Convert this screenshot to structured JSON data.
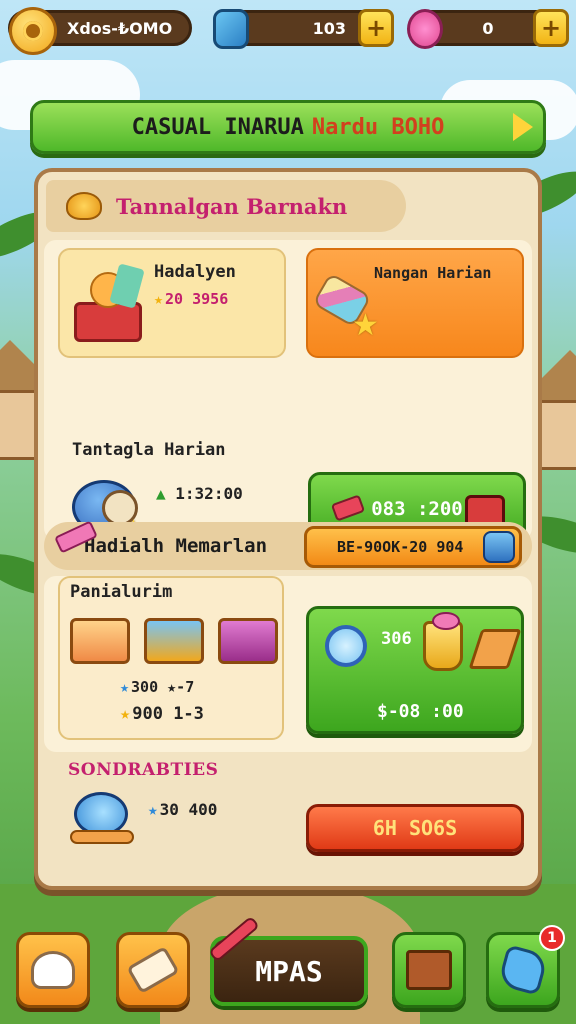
{
  "hud": {
    "coins_label": "Xdos-₺OMO",
    "resource_value": "103",
    "gems_value": "0",
    "plus": "+"
  },
  "banner": {
    "title": "CASUAL INARUA",
    "title_accent": "Nardu BOHO"
  },
  "panel": {
    "header": "Tannalgan Barnakn",
    "card_a": {
      "title": "Hadalyen",
      "value": "20 3956",
      "star": "★"
    },
    "card_b": {
      "title": "Nangan Harian"
    },
    "row2": {
      "title": "Tantagla Harian",
      "timer": "1:32:00",
      "timer_prefix": "▲",
      "claim": "083 :200"
    },
    "section2": {
      "title": "Hadialh Memarlan",
      "pill": "BE-90OK-20 904"
    },
    "packages": {
      "title": "Panialurim",
      "line1": "300 ★-7",
      "line2": "900 1-3",
      "line1_star": "★",
      "line2_star": "★"
    },
    "claim2": {
      "top": "306",
      "bottom": "$-08 :00"
    },
    "section3": {
      "title": "SONDRABTIES",
      "value": "30 400",
      "value_star": "★",
      "button": "6H SO6S"
    }
  },
  "bottom_nav": {
    "map_label": "MPAS",
    "badge": "1"
  },
  "colors": {
    "accent_green": "#4fb82a",
    "accent_orange": "#f7871c",
    "accent_red": "#e03a16",
    "title_pink": "#c4206e"
  },
  "icons": [
    "coin-icon",
    "potion-icon",
    "gem-icon",
    "plus-icon",
    "arrow-right-icon",
    "candy-icon",
    "basket-icon",
    "cone-icon",
    "stopwatch-icon",
    "key-icon",
    "chest-icon",
    "eraser-icon",
    "jar-icon",
    "box-icon",
    "magnifier-icon",
    "trophy-icon",
    "wedge-icon",
    "snail-icon",
    "mushroom-icon",
    "hammer-icon",
    "pencil-icon",
    "gift-icon",
    "shape-icon"
  ]
}
